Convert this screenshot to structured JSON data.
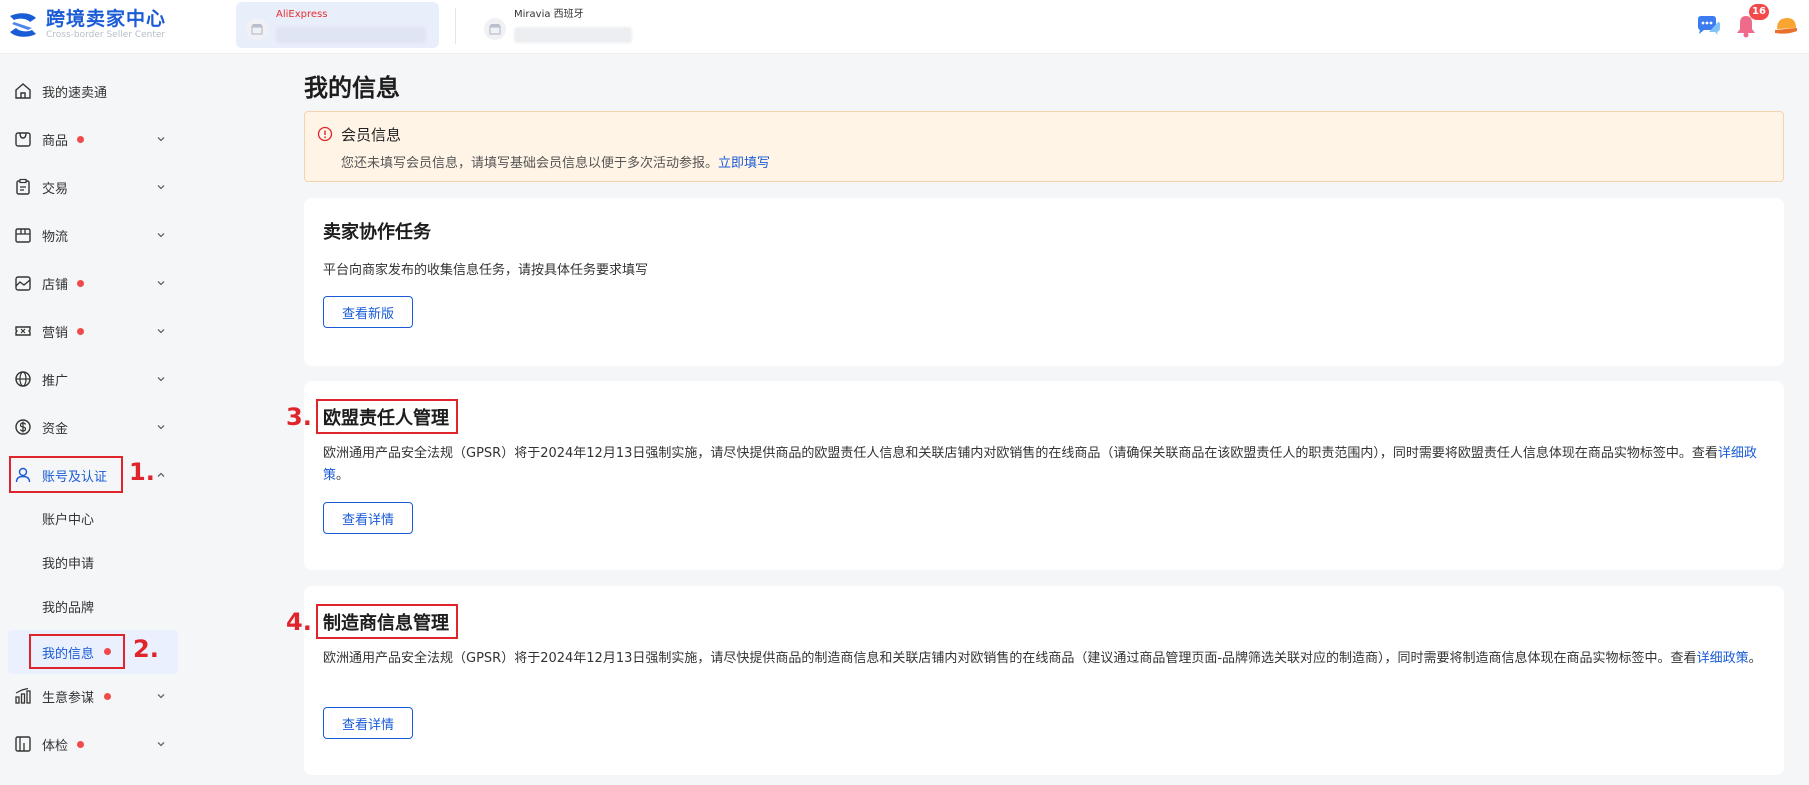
{
  "header": {
    "logo_title": "跨境卖家中心",
    "logo_subtitle": "Cross-border Seller Center",
    "shops": [
      {
        "name": "AliExpress",
        "active": true
      },
      {
        "name": "Miravia 西班牙",
        "active": false
      }
    ],
    "notification_count": "16",
    "icons": [
      "chat-icon",
      "bell-icon",
      "user-avatar-icon"
    ],
    "accent_color": "#1a5bd6",
    "alert_color": "#f24a4a"
  },
  "sidebar": {
    "items": [
      {
        "label": "我的速卖通",
        "icon": "home-icon",
        "dot": false,
        "arrow": false
      },
      {
        "label": "商品",
        "icon": "product-icon",
        "dot": true,
        "arrow": true
      },
      {
        "label": "交易",
        "icon": "clipboard-icon",
        "dot": false,
        "arrow": true
      },
      {
        "label": "物流",
        "icon": "box-icon",
        "dot": false,
        "arrow": true
      },
      {
        "label": "店铺",
        "icon": "store-icon",
        "dot": true,
        "arrow": true
      },
      {
        "label": "营销",
        "icon": "ticket-icon",
        "dot": true,
        "arrow": true
      },
      {
        "label": "推广",
        "icon": "globe-icon",
        "dot": false,
        "arrow": true
      },
      {
        "label": "资金",
        "icon": "dollar-icon",
        "dot": false,
        "arrow": true
      },
      {
        "label": "账号及认证",
        "icon": "user-icon",
        "dot": false,
        "arrow": true,
        "expanded": true
      }
    ],
    "sub_items": [
      {
        "label": "账户中心"
      },
      {
        "label": "我的申请"
      },
      {
        "label": "我的品牌"
      },
      {
        "label": "我的信息",
        "selected": true,
        "dot": true
      }
    ],
    "bottom_items": [
      {
        "label": "生意参谋",
        "icon": "bar-chart-icon",
        "dot": true,
        "arrow": true
      },
      {
        "label": "体检",
        "icon": "checkup-icon",
        "dot": true,
        "arrow": true
      }
    ]
  },
  "main": {
    "page_title": "我的信息",
    "alert": {
      "title": "会员信息",
      "text": "您还未填写会员信息，请填写基础会员信息以便于多次活动参报。",
      "link": "立即填写"
    },
    "cards": [
      {
        "title": "卖家协作任务",
        "text": "平台向商家发布的收集信息任务，请按具体任务要求填写",
        "button": "查看新版"
      },
      {
        "title": "欧盟责任人管理",
        "text": "欧洲通用产品安全法规（GPSR）将于2024年12月13日强制实施，请尽快提供商品的欧盟责任人信息和关联店铺内对欧销售的在线商品（请确保关联商品在该欧盟责任人的职责范围内），同时需要将欧盟责任人信息体现在商品实物标签中。查看",
        "link": "详细政策",
        "suffix": "。",
        "button": "查看详情"
      },
      {
        "title": "制造商信息管理",
        "text": "欧洲通用产品安全法规（GPSR）将于2024年12月13日强制实施，请尽快提供商品的制造商信息和关联店铺内对欧销售的在线商品（建议通过商品管理页面-品牌筛选关联对应的制造商），同时需要将制造商信息体现在商品实物标签中。查看",
        "link": "详细政策",
        "suffix": "。",
        "button": "查看详情"
      }
    ]
  },
  "annotations": {
    "marker_1": "1.",
    "marker_2": "2.",
    "marker_3": "3.",
    "marker_4": "4.",
    "color": "#e0242c"
  }
}
